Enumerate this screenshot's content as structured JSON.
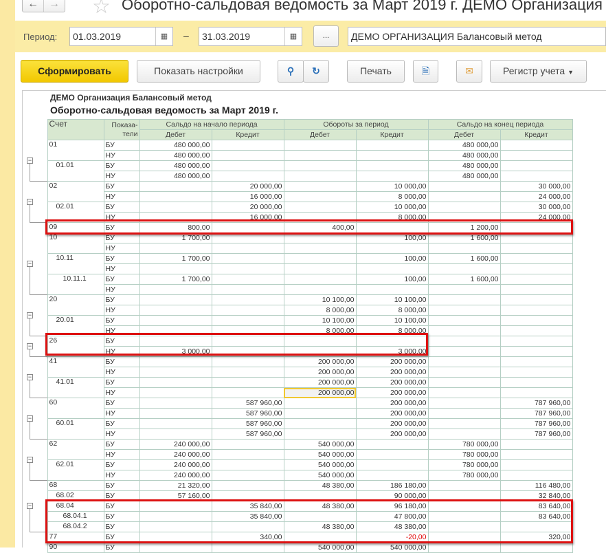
{
  "window": {
    "title": "Оборотно-сальдовая ведомость за Март 2019 г. ДЕМО Организация"
  },
  "period": {
    "label": "Период:",
    "from": "01.03.2019",
    "to": "31.03.2019",
    "dash": "–",
    "more": "...",
    "org": "ДЕМО ОРГАНИЗАЦИЯ Балансовый метод"
  },
  "toolbar": {
    "generate": "Сформировать",
    "settings": "Показать настройки",
    "print": "Печать",
    "register": "Регистр учета"
  },
  "report": {
    "org": "ДЕМО Организация Балансовый метод",
    "title": "Оборотно-сальдовая ведомость за Март 2019 г.",
    "headers": {
      "account": "Счет",
      "indicators": "Показа-\nтели",
      "opening": "Сальдо на начало периода",
      "turnover": "Обороты за период",
      "closing": "Сальдо на конец периода",
      "debit": "Дебет",
      "credit": "Кредит"
    },
    "groups": [
      {
        "accounts": [
          {
            "acct": "01",
            "level": 0,
            "rows": [
              [
                "БУ",
                "480 000,00",
                "",
                "",
                "",
                "480 000,00",
                ""
              ],
              [
                "НУ",
                "480 000,00",
                "",
                "",
                "",
                "480 000,00",
                ""
              ]
            ]
          },
          {
            "acct": "01.01",
            "level": 1,
            "rows": [
              [
                "БУ",
                "480 000,00",
                "",
                "",
                "",
                "480 000,00",
                ""
              ],
              [
                "НУ",
                "480 000,00",
                "",
                "",
                "",
                "480 000,00",
                ""
              ]
            ]
          }
        ]
      },
      {
        "accounts": [
          {
            "acct": "02",
            "level": 0,
            "rows": [
              [
                "БУ",
                "",
                "20 000,00",
                "",
                "10 000,00",
                "",
                "30 000,00"
              ],
              [
                "НУ",
                "",
                "16 000,00",
                "",
                "8 000,00",
                "",
                "24 000,00"
              ]
            ]
          },
          {
            "acct": "02.01",
            "level": 1,
            "rows": [
              [
                "БУ",
                "",
                "20 000,00",
                "",
                "10 000,00",
                "",
                "30 000,00"
              ],
              [
                "НУ",
                "",
                "16 000,00",
                "",
                "8 000,00",
                "",
                "24 000,00"
              ]
            ]
          }
        ]
      },
      {
        "accounts": [
          {
            "acct": "09",
            "level": 0,
            "rows": [
              [
                "БУ",
                "800,00",
                "",
                "400,00",
                "",
                "1 200,00",
                ""
              ]
            ]
          }
        ]
      },
      {
        "accounts": [
          {
            "acct": "10",
            "level": 0,
            "rows": [
              [
                "БУ",
                "1 700,00",
                "",
                "",
                "100,00",
                "1 600,00",
                ""
              ],
              [
                "НУ",
                "",
                "",
                "",
                "",
                "",
                ""
              ]
            ]
          },
          {
            "acct": "10.11",
            "level": 1,
            "rows": [
              [
                "БУ",
                "1 700,00",
                "",
                "",
                "100,00",
                "1 600,00",
                ""
              ],
              [
                "НУ",
                "",
                "",
                "",
                "",
                "",
                ""
              ]
            ]
          },
          {
            "acct": "10.11.1",
            "level": 2,
            "rows": [
              [
                "БУ",
                "1 700,00",
                "",
                "",
                "100,00",
                "1 600,00",
                ""
              ],
              [
                "НУ",
                "",
                "",
                "",
                "",
                "",
                ""
              ]
            ]
          }
        ]
      },
      {
        "accounts": [
          {
            "acct": "20",
            "level": 0,
            "rows": [
              [
                "БУ",
                "",
                "",
                "10 100,00",
                "10 100,00",
                "",
                ""
              ],
              [
                "НУ",
                "",
                "",
                "8 000,00",
                "8 000,00",
                "",
                ""
              ]
            ]
          },
          {
            "acct": "20.01",
            "level": 1,
            "rows": [
              [
                "БУ",
                "",
                "",
                "10 100,00",
                "10 100,00",
                "",
                ""
              ],
              [
                "НУ",
                "",
                "",
                "8 000,00",
                "8 000,00",
                "",
                ""
              ]
            ]
          }
        ]
      },
      {
        "accounts": [
          {
            "acct": "26",
            "level": 0,
            "rows": [
              [
                "БУ",
                "",
                "",
                "",
                "",
                "",
                ""
              ],
              [
                "НУ",
                "3 000,00",
                "",
                "",
                "3 000,00",
                "",
                ""
              ]
            ]
          }
        ]
      },
      {
        "accounts": [
          {
            "acct": "41",
            "level": 0,
            "rows": [
              [
                "БУ",
                "",
                "",
                "200 000,00",
                "200 000,00",
                "",
                ""
              ],
              [
                "НУ",
                "",
                "",
                "200 000,00",
                "200 000,00",
                "",
                ""
              ]
            ]
          },
          {
            "acct": "41.01",
            "level": 1,
            "rows": [
              [
                "БУ",
                "",
                "",
                "200 000,00",
                "200 000,00",
                "",
                ""
              ],
              [
                "НУ",
                "",
                "",
                "200 000,00",
                "200 000,00",
                "",
                ""
              ]
            ]
          }
        ]
      },
      {
        "accounts": [
          {
            "acct": "60",
            "level": 0,
            "rows": [
              [
                "БУ",
                "",
                "587 960,00",
                "",
                "200 000,00",
                "",
                "787 960,00"
              ],
              [
                "НУ",
                "",
                "587 960,00",
                "",
                "200 000,00",
                "",
                "787 960,00"
              ]
            ]
          },
          {
            "acct": "60.01",
            "level": 1,
            "rows": [
              [
                "БУ",
                "",
                "587 960,00",
                "",
                "200 000,00",
                "",
                "787 960,00"
              ],
              [
                "НУ",
                "",
                "587 960,00",
                "",
                "200 000,00",
                "",
                "787 960,00"
              ]
            ]
          }
        ]
      },
      {
        "accounts": [
          {
            "acct": "62",
            "level": 0,
            "rows": [
              [
                "БУ",
                "240 000,00",
                "",
                "540 000,00",
                "",
                "780 000,00",
                ""
              ],
              [
                "НУ",
                "240 000,00",
                "",
                "540 000,00",
                "",
                "780 000,00",
                ""
              ]
            ]
          },
          {
            "acct": "62.01",
            "level": 1,
            "rows": [
              [
                "БУ",
                "240 000,00",
                "",
                "540 000,00",
                "",
                "780 000,00",
                ""
              ],
              [
                "НУ",
                "240 000,00",
                "",
                "540 000,00",
                "",
                "780 000,00",
                ""
              ]
            ]
          }
        ]
      },
      {
        "accounts": [
          {
            "acct": "68",
            "level": 0,
            "rows": [
              [
                "БУ",
                "21 320,00",
                "",
                "48 380,00",
                "186 180,00",
                "",
                "116 480,00"
              ]
            ]
          },
          {
            "acct": "68.02",
            "level": 1,
            "rows": [
              [
                "БУ",
                "57 160,00",
                "",
                "",
                "90 000,00",
                "",
                "32 840,00"
              ]
            ]
          },
          {
            "acct": "68.04",
            "level": 1,
            "rows": [
              [
                "БУ",
                "",
                "35 840,00",
                "48 380,00",
                "96 180,00",
                "",
                "83 640,00"
              ]
            ]
          },
          {
            "acct": "68.04.1",
            "level": 2,
            "rows": [
              [
                "БУ",
                "",
                "35 840,00",
                "",
                "47 800,00",
                "",
                "83 640,00"
              ]
            ]
          },
          {
            "acct": "68.04.2",
            "level": 2,
            "rows": [
              [
                "БУ",
                "",
                "",
                "48 380,00",
                "48 380,00",
                "",
                ""
              ]
            ]
          }
        ]
      },
      {
        "accounts": [
          {
            "acct": "77",
            "level": 0,
            "rows": [
              [
                "БУ",
                "",
                "340,00",
                "",
                "-20,00",
                "",
                "320,00"
              ]
            ]
          }
        ]
      },
      {
        "accounts": [
          {
            "acct": "90",
            "level": 0,
            "rows": [
              [
                "БУ",
                "",
                "",
                "540 000,00",
                "540 000,00",
                "",
                ""
              ]
            ]
          }
        ]
      }
    ]
  },
  "colors": {
    "negative": "#e00000",
    "highlight_box": "#dd1111",
    "header_bg": "#d8e8d0",
    "primary_button": "#f5d313"
  }
}
